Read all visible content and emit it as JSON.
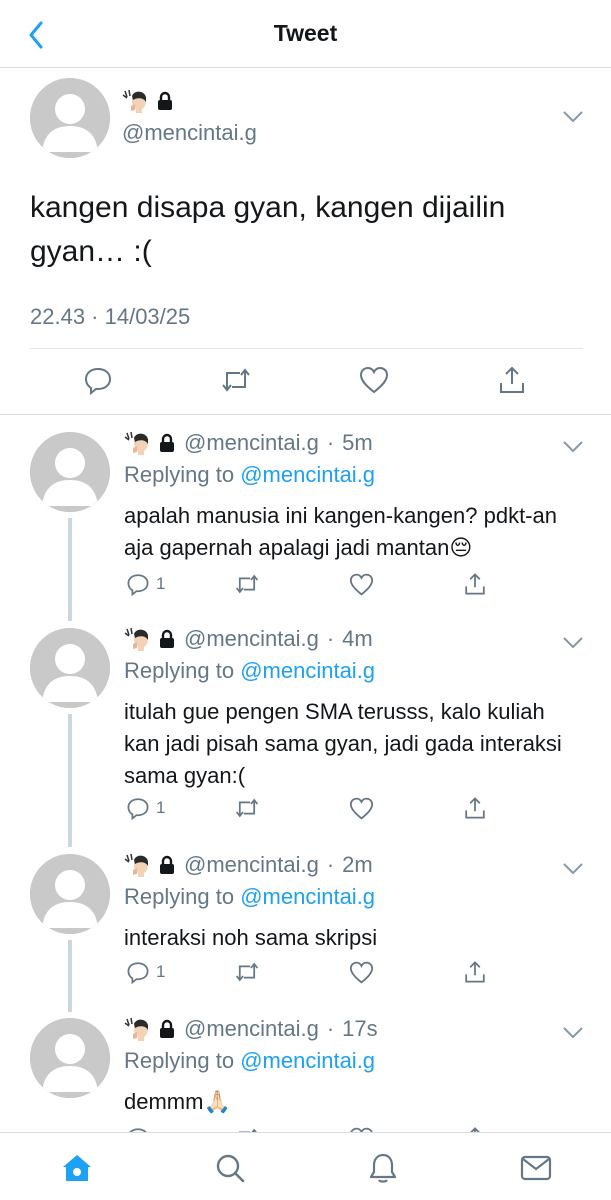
{
  "header": {
    "title": "Tweet",
    "back_icon": "chevron-left-icon"
  },
  "colors": {
    "accent": "#1da1f2",
    "muted": "#657786",
    "text": "#14171a",
    "divider": "#d8dde1"
  },
  "main_tweet": {
    "handle": "@mencintai.g",
    "text": "kangen disapa gyan, kangen dijailin gyan… :(",
    "timestamp": "22.43 · 14/03/25"
  },
  "replies": [
    {
      "handle": "@mencintai.g",
      "sep": "·",
      "time": "5m",
      "replying_prefix": "Replying to",
      "replying_to": "@mencintai.g",
      "text": "apalah manusia ini kangen-kangen? pdkt-an aja gapernah apalagi jadi mantan😔",
      "reply_count": "1"
    },
    {
      "handle": "@mencintai.g",
      "sep": "·",
      "time": "4m",
      "replying_prefix": "Replying to",
      "replying_to": "@mencintai.g",
      "text": "itulah gue pengen SMA terusss, kalo kuliah kan jadi pisah sama gyan, jadi gada interaksi sama gyan:(",
      "reply_count": "1"
    },
    {
      "handle": "@mencintai.g",
      "sep": "·",
      "time": "2m",
      "replying_prefix": "Replying to",
      "replying_to": "@mencintai.g",
      "text": "interaksi noh sama skripsi",
      "reply_count": "1"
    },
    {
      "handle": "@mencintai.g",
      "sep": "·",
      "time": "17s",
      "replying_prefix": "Replying to",
      "replying_to": "@mencintai.g",
      "text": "demmm🙏🏻",
      "reply_count": ""
    }
  ],
  "bottom_nav": [
    "home-icon",
    "search-icon",
    "notifications-icon",
    "messages-icon"
  ]
}
